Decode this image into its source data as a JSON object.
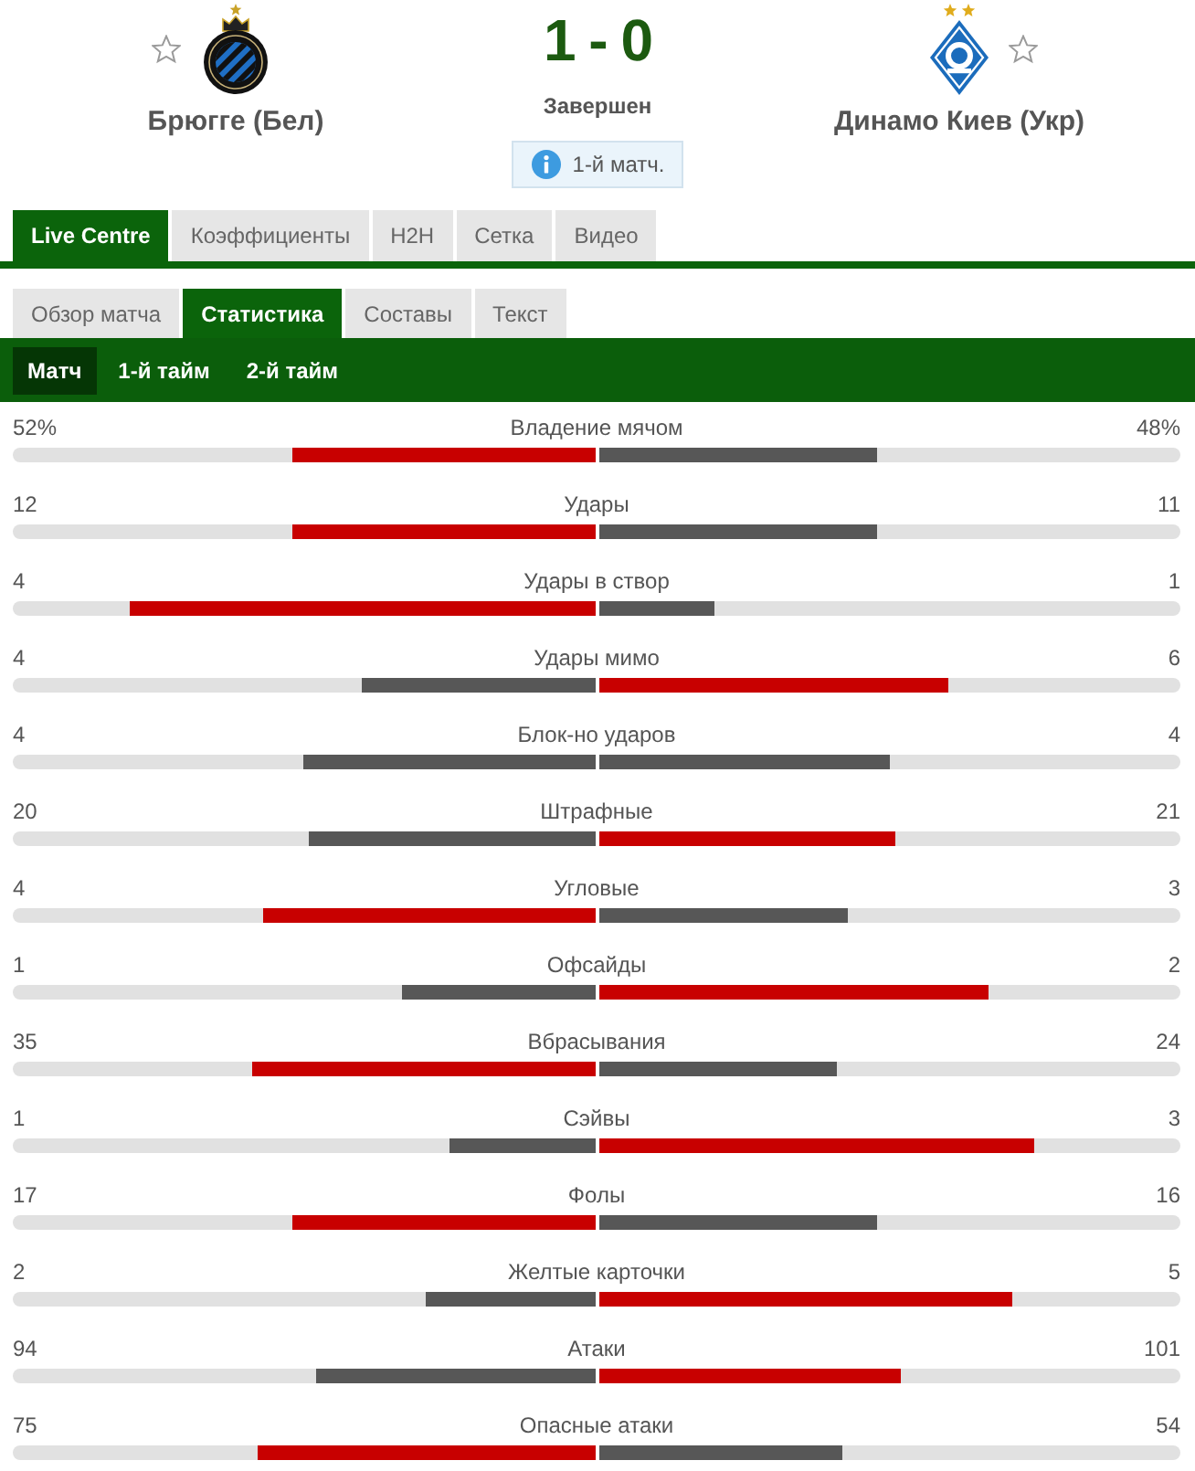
{
  "match": {
    "home": {
      "name": "Брюгге (Бел)",
      "favorite": false
    },
    "score": "1 - 0",
    "status": "Завершен",
    "info": "1-й матч.",
    "away": {
      "name": "Динамо Киев (Укр)",
      "favorite": false
    }
  },
  "tabs": [
    {
      "label": "Live Centre",
      "selected": true
    },
    {
      "label": "Коэффициенты",
      "selected": false
    },
    {
      "label": "H2H",
      "selected": false
    },
    {
      "label": "Сетка",
      "selected": false
    },
    {
      "label": "Видео",
      "selected": false
    }
  ],
  "subtabs": [
    {
      "label": "Обзор матча",
      "selected": false
    },
    {
      "label": "Статистика",
      "selected": true
    },
    {
      "label": "Составы",
      "selected": false
    },
    {
      "label": "Текст",
      "selected": false
    }
  ],
  "periods": [
    {
      "label": "Матч",
      "selected": true
    },
    {
      "label": "1-й тайм",
      "selected": false
    },
    {
      "label": "2-й тайм",
      "selected": false
    }
  ],
  "stats": [
    {
      "label": "Владение мячом",
      "home": {
        "value": "52%",
        "level": 0.52,
        "highlighted": true
      },
      "away": {
        "value": "48%",
        "level": 0.48,
        "highlighted": false
      }
    },
    {
      "label": "Удары",
      "home": {
        "value": "12",
        "level": 0.52,
        "highlighted": true
      },
      "away": {
        "value": "11",
        "level": 0.48,
        "highlighted": false
      }
    },
    {
      "label": "Удары в створ",
      "home": {
        "value": "4",
        "level": 0.8,
        "highlighted": true
      },
      "away": {
        "value": "1",
        "level": 0.2,
        "highlighted": false
      }
    },
    {
      "label": "Удары мимо",
      "home": {
        "value": "4",
        "level": 0.4,
        "highlighted": false
      },
      "away": {
        "value": "6",
        "level": 0.6,
        "highlighted": true
      }
    },
    {
      "label": "Блок-но ударов",
      "home": {
        "value": "4",
        "level": 0.5,
        "highlighted": false
      },
      "away": {
        "value": "4",
        "level": 0.5,
        "highlighted": false
      }
    },
    {
      "label": "Штрафные",
      "home": {
        "value": "20",
        "level": 0.49,
        "highlighted": false
      },
      "away": {
        "value": "21",
        "level": 0.51,
        "highlighted": true
      }
    },
    {
      "label": "Угловые",
      "home": {
        "value": "4",
        "level": 0.57,
        "highlighted": true
      },
      "away": {
        "value": "3",
        "level": 0.43,
        "highlighted": false
      }
    },
    {
      "label": "Офсайды",
      "home": {
        "value": "1",
        "level": 0.33,
        "highlighted": false
      },
      "away": {
        "value": "2",
        "level": 0.67,
        "highlighted": true
      }
    },
    {
      "label": "Вбрасывания",
      "home": {
        "value": "35",
        "level": 0.59,
        "highlighted": true
      },
      "away": {
        "value": "24",
        "level": 0.41,
        "highlighted": false
      }
    },
    {
      "label": "Сэйвы",
      "home": {
        "value": "1",
        "level": 0.25,
        "highlighted": false
      },
      "away": {
        "value": "3",
        "level": 0.75,
        "highlighted": true
      }
    },
    {
      "label": "Фолы",
      "home": {
        "value": "17",
        "level": 0.52,
        "highlighted": true
      },
      "away": {
        "value": "16",
        "level": 0.48,
        "highlighted": false
      }
    },
    {
      "label": "Желтые карточки",
      "home": {
        "value": "2",
        "level": 0.29,
        "highlighted": false
      },
      "away": {
        "value": "5",
        "level": 0.71,
        "highlighted": true
      }
    },
    {
      "label": "Атаки",
      "home": {
        "value": "94",
        "level": 0.48,
        "highlighted": false
      },
      "away": {
        "value": "101",
        "level": 0.52,
        "highlighted": true
      }
    },
    {
      "label": "Опасные атаки",
      "home": {
        "value": "75",
        "level": 0.58,
        "highlighted": true
      },
      "away": {
        "value": "54",
        "level": 0.42,
        "highlighted": false
      }
    }
  ]
}
